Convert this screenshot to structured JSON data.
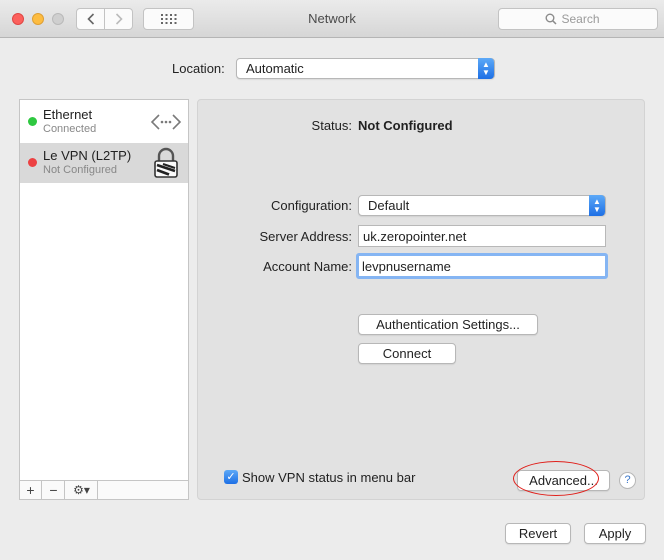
{
  "window": {
    "title": "Network"
  },
  "search": {
    "placeholder": "Search"
  },
  "location": {
    "label": "Location:",
    "value": "Automatic"
  },
  "services": [
    {
      "name": "Ethernet",
      "status": "Connected",
      "status_color": "#2ec840",
      "icon": "ethernet-arrows-icon"
    },
    {
      "name": "Le VPN (L2TP)",
      "status": "Not Configured",
      "status_color": "#ec4142",
      "icon": "vpn-lock-icon"
    }
  ],
  "list_toolbar": {
    "add": "+",
    "remove": "−",
    "actions": "⚙︎▾"
  },
  "detail": {
    "status_label": "Status:",
    "status_value": "Not Configured",
    "configuration_label": "Configuration:",
    "configuration_value": "Default",
    "server_label": "Server Address:",
    "server_value": "uk.zeropointer.net",
    "account_label": "Account Name:",
    "account_value": "levpnusername",
    "auth_button": "Authentication Settings...",
    "connect_button": "Connect",
    "show_status_label": "Show VPN status in menu bar",
    "show_status_checked": true,
    "advanced_button": "Advanced...",
    "help_button": "?"
  },
  "footer": {
    "revert": "Revert",
    "apply": "Apply"
  },
  "colors": {
    "accent": "#1d6fe5",
    "highlight_circle": "#e0201b"
  }
}
